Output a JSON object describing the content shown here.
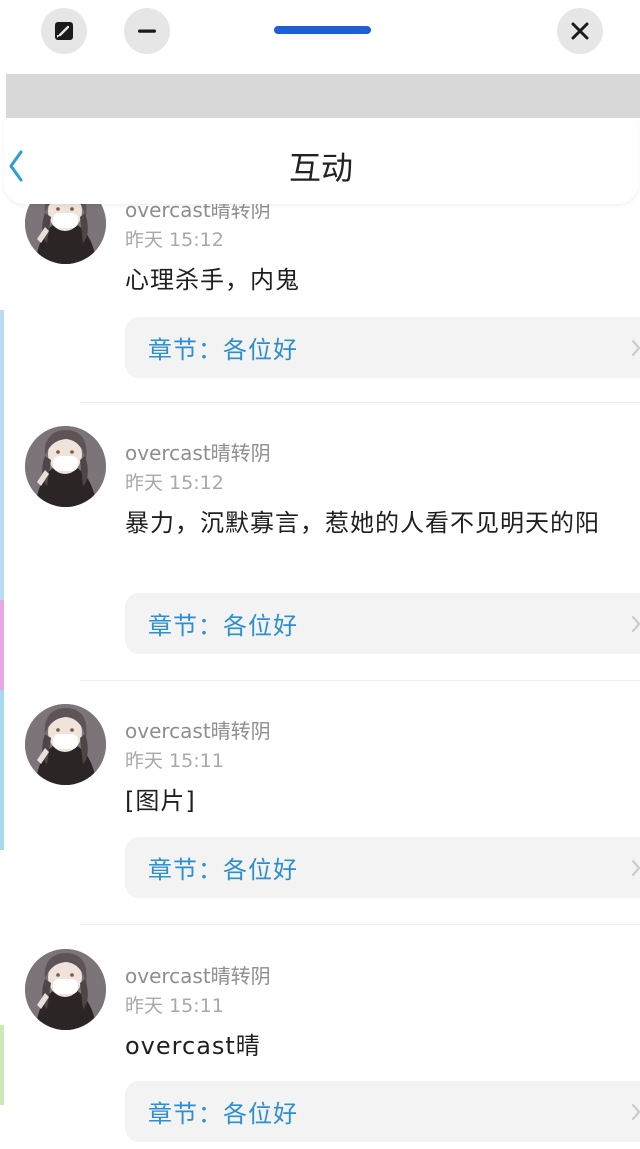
{
  "window": {
    "resize_icon": "resize-icon",
    "minimize_icon": "minus-icon",
    "close_icon": "close-icon",
    "handle_color": "#1f5fd6"
  },
  "header": {
    "back_icon": "chevron-left-icon",
    "title": "互动"
  },
  "colors": {
    "accent": "#2b8fd0",
    "back_arrow": "#2f9bdf",
    "chapter_bg": "#f3f3f3"
  },
  "posts": [
    {
      "username": "overcast晴转阴",
      "time": "昨天 15:12",
      "content": "心理杀手，内鬼",
      "chapter": "章节：各位好"
    },
    {
      "username": "overcast晴转阴",
      "time": "昨天 15:12",
      "content": "暴力，沉默寡言，惹她的人看不见明天的阳",
      "chapter": "章节：各位好"
    },
    {
      "username": "overcast晴转阴",
      "time": "昨天 15:11",
      "content": "[图片]",
      "chapter": "章节：各位好"
    },
    {
      "username": "overcast晴转阴",
      "time": "昨天 15:11",
      "content": "overcast晴",
      "chapter": "章节：各位好"
    }
  ]
}
